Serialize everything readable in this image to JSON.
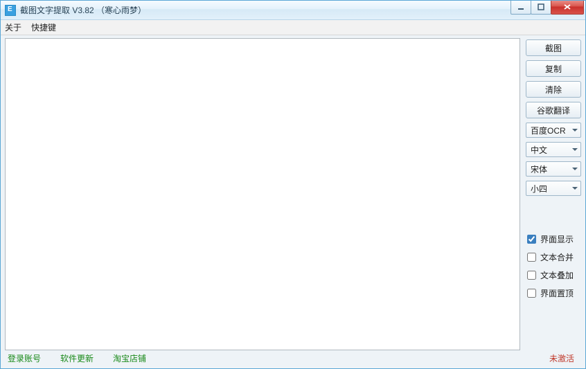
{
  "window": {
    "title": "截图文字提取 V3.82 （寒心雨梦）"
  },
  "menu": {
    "about": "关于",
    "hotkey": "快捷键"
  },
  "textarea": {
    "value": "",
    "placeholder": ""
  },
  "buttons": {
    "screenshot": "截图",
    "copy": "复制",
    "clear": "清除",
    "google_translate": "谷歌翻译"
  },
  "dropdowns": {
    "ocr_engine": {
      "selected": "百度OCR"
    },
    "language": {
      "selected": "中文"
    },
    "font_family": {
      "selected": "宋体"
    },
    "font_size": {
      "selected": "小四"
    }
  },
  "checkboxes": {
    "ui_display": {
      "label": "界面显示",
      "checked": true
    },
    "text_merge": {
      "label": "文本合并",
      "checked": false
    },
    "text_overlay": {
      "label": "文本叠加",
      "checked": false
    },
    "always_on_top": {
      "label": "界面置顶",
      "checked": false
    }
  },
  "footer": {
    "login": "登录账号",
    "update": "软件更新",
    "taobao": "淘宝店铺",
    "activation_status": "未激活"
  }
}
